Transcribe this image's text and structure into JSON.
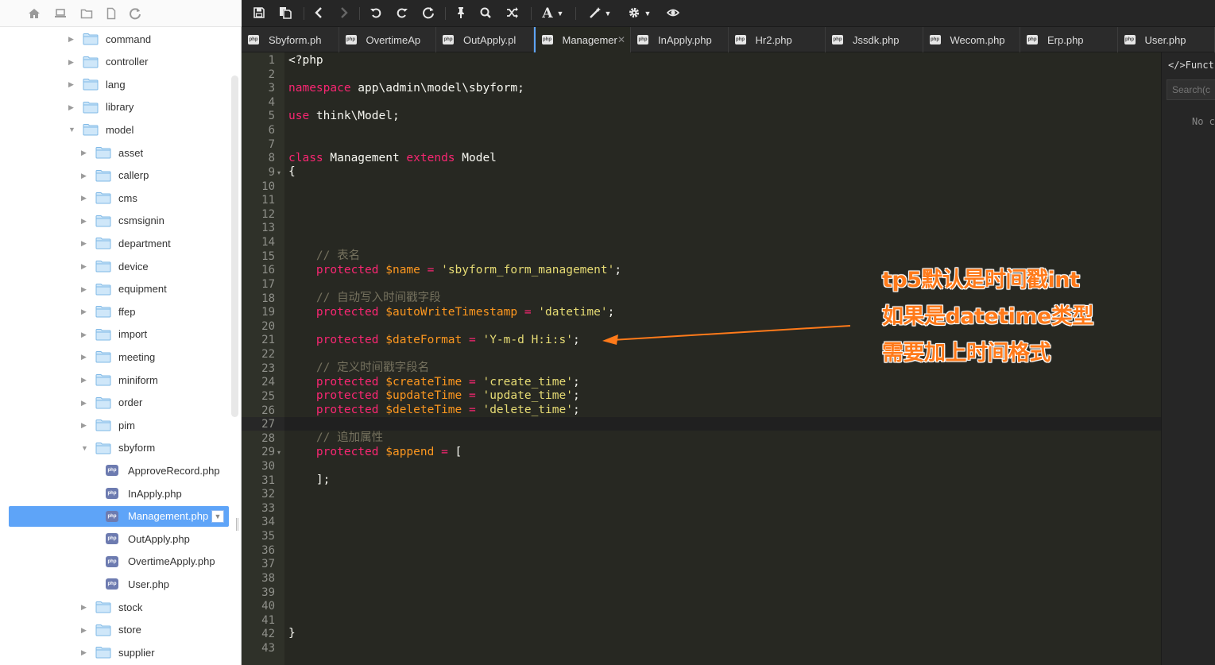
{
  "sidebar": {
    "toolbar_icons": [
      "home-icon",
      "laptop-icon",
      "folder-icon",
      "file-icon",
      "refresh-icon"
    ],
    "tree": [
      {
        "label": "command",
        "type": "folder",
        "state": "collapsed"
      },
      {
        "label": "controller",
        "type": "folder",
        "state": "collapsed"
      },
      {
        "label": "lang",
        "type": "folder",
        "state": "collapsed"
      },
      {
        "label": "library",
        "type": "folder",
        "state": "collapsed"
      },
      {
        "label": "model",
        "type": "folder",
        "state": "expanded"
      },
      {
        "label": "asset",
        "type": "folder",
        "state": "collapsed"
      },
      {
        "label": "callerp",
        "type": "folder",
        "state": "collapsed"
      },
      {
        "label": "cms",
        "type": "folder",
        "state": "collapsed"
      },
      {
        "label": "csmsignin",
        "type": "folder",
        "state": "collapsed"
      },
      {
        "label": "department",
        "type": "folder",
        "state": "collapsed"
      },
      {
        "label": "device",
        "type": "folder",
        "state": "collapsed"
      },
      {
        "label": "equipment",
        "type": "folder",
        "state": "collapsed"
      },
      {
        "label": "ffep",
        "type": "folder",
        "state": "collapsed"
      },
      {
        "label": "import",
        "type": "folder",
        "state": "collapsed"
      },
      {
        "label": "meeting",
        "type": "folder",
        "state": "collapsed"
      },
      {
        "label": "miniform",
        "type": "folder",
        "state": "collapsed"
      },
      {
        "label": "order",
        "type": "folder",
        "state": "collapsed"
      },
      {
        "label": "pim",
        "type": "folder",
        "state": "collapsed"
      },
      {
        "label": "sbyform",
        "type": "folder",
        "state": "expanded"
      },
      {
        "label": "ApproveRecord.php",
        "type": "file"
      },
      {
        "label": "InApply.php",
        "type": "file"
      },
      {
        "label": "Management.php",
        "type": "file",
        "selected": true
      },
      {
        "label": "OutApply.php",
        "type": "file"
      },
      {
        "label": "OvertimeApply.php",
        "type": "file"
      },
      {
        "label": "User.php",
        "type": "file"
      },
      {
        "label": "stock",
        "type": "folder",
        "state": "collapsed"
      },
      {
        "label": "store",
        "type": "folder",
        "state": "collapsed"
      },
      {
        "label": "supplier",
        "type": "folder",
        "state": "collapsed"
      }
    ]
  },
  "toolbar": {
    "icons": [
      "save-icon",
      "save-all-icon",
      "back-icon",
      "forward-icon",
      "undo-icon",
      "redo-icon",
      "reload-icon",
      "pin-icon",
      "search-icon",
      "shuffle-icon",
      "font-icon",
      "magic-wand-icon",
      "gear-icon",
      "eye-icon"
    ],
    "font_label": "A"
  },
  "tabs": [
    {
      "label": "Sbyform.ph"
    },
    {
      "label": "OvertimeAp"
    },
    {
      "label": "OutApply.pl"
    },
    {
      "label": "Managemer",
      "active": true
    },
    {
      "label": "InApply.php"
    },
    {
      "label": "Hr2.php"
    },
    {
      "label": "Jssdk.php"
    },
    {
      "label": "Wecom.php"
    },
    {
      "label": "Erp.php"
    },
    {
      "label": "User.php"
    }
  ],
  "editor": {
    "line_numbers": [
      "1",
      "2",
      "3",
      "4",
      "5",
      "6",
      "7",
      "8",
      "9",
      "10",
      "11",
      "12",
      "13",
      "14",
      "15",
      "16",
      "17",
      "18",
      "19",
      "20",
      "21",
      "22",
      "23",
      "24",
      "25",
      "26",
      "27",
      "28",
      "29",
      "30",
      "31",
      "32",
      "33",
      "34",
      "35",
      "36",
      "37",
      "38",
      "39",
      "40",
      "41",
      "42",
      "43"
    ],
    "code": {
      "l1": "<?php",
      "l3_kw": "namespace",
      "l3_rest": " app\\admin\\model\\sbyform;",
      "l5_kw": "use",
      "l5_rest": " think\\Model;",
      "l8_kw1": "class",
      "l8_name": " Management ",
      "l8_kw2": "extends",
      "l8_rest": " Model",
      "l9": "{",
      "l15": "    // 表名",
      "l16_kw": "    protected",
      "l16_var": " $name",
      "l16_op": " =",
      "l16_str": " 'sbyform_form_management'",
      "l16_end": ";",
      "l18": "    // 自动写入时间戳字段",
      "l19_kw": "    protected",
      "l19_var": " $autoWriteTimestamp",
      "l19_op": " =",
      "l19_str": " 'datetime'",
      "l19_end": ";",
      "l21_kw": "    protected",
      "l21_var": " $dateFormat",
      "l21_op": " =",
      "l21_str": " 'Y-m-d H:i:s'",
      "l21_end": ";",
      "l23": "    // 定义时间戳字段名",
      "l24_kw": "    protected",
      "l24_var": " $createTime",
      "l24_op": " =",
      "l24_str": " 'create_time'",
      "l24_end": ";",
      "l25_kw": "    protected",
      "l25_var": " $updateTime",
      "l25_op": " =",
      "l25_str": " 'update_time'",
      "l25_end": ";",
      "l26_kw": "    protected",
      "l26_var": " $deleteTime",
      "l26_op": " =",
      "l26_str": " 'delete_time'",
      "l26_end": ";",
      "l28": "    // 追加属性",
      "l29_kw": "    protected",
      "l29_var": " $append",
      "l29_op": " =",
      "l29_rest": " [",
      "l31": "    ];",
      "l42": "}"
    },
    "active_line": 27,
    "fold_lines": [
      9,
      29
    ]
  },
  "right_panel": {
    "title": "</>Funct",
    "search_placeholder": "Search(c",
    "empty_text": "No c"
  },
  "annotation": {
    "lines": [
      "tp5默认是时间戳int",
      "如果是datetime类型",
      "需要加上时间格式"
    ],
    "color": "#ff7a1a"
  },
  "colors": {
    "editor_bg": "#272822",
    "keyword": "#f92672",
    "variable": "#fd971f",
    "string": "#e6db74",
    "comment": "#75715e",
    "selection": "#5ea4f8"
  }
}
